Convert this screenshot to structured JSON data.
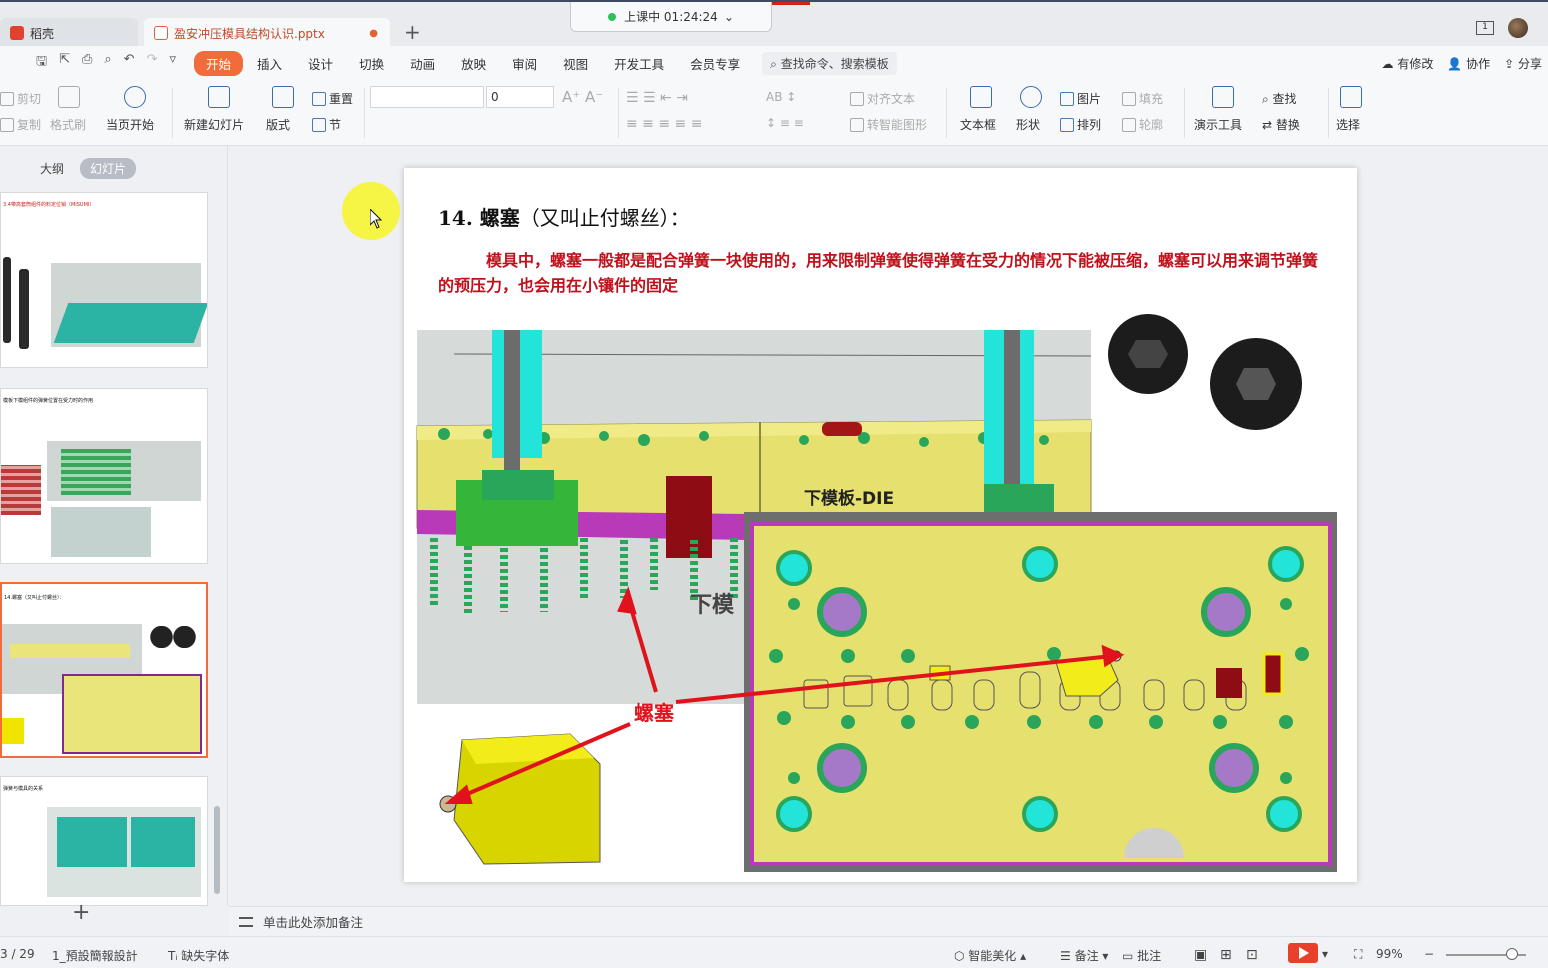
{
  "titlebar": {
    "home_tab": "稻壳",
    "doc_tab": "盈安冲压模具结构认识.pptx",
    "class_status": "上课中 01:24:24",
    "class_chevron": "⌄",
    "add_tab_icon": "+",
    "window_badge": "1"
  },
  "menubar": {
    "items": [
      "开始",
      "插入",
      "设计",
      "切换",
      "动画",
      "放映",
      "审阅",
      "视图",
      "开发工具",
      "会员专享"
    ],
    "search": "查找命令、搜索模板",
    "right": [
      "有修改",
      "协作",
      "分享"
    ]
  },
  "ribbon": {
    "cut": "剪切",
    "copy": "复制",
    "format_painter": "格式刷",
    "play_from_current": "当页开始",
    "new_slide": "新建幻灯片",
    "layout": "版式",
    "reset": "重置",
    "section": "节",
    "font_size": "0",
    "align_text": "对齐文本",
    "convert_smartart": "转智能图形",
    "textbox": "文本框",
    "shape": "形状",
    "picture": "图片",
    "arrange": "排列",
    "fill": "填充",
    "outline": "轮廓",
    "presenter_tools": "演示工具",
    "find": "查找",
    "replace": "替换",
    "select": "选择"
  },
  "left_panel": {
    "tabs": [
      "大纲",
      "幻灯片"
    ],
    "thumb_titles": [
      "3.4带高套筒组件的料定位销（MISUMI）",
      "模板下模组件的弹簧位置在受力时的作用",
      "14.螺塞（又叫止付螺丝）：",
      "弹簧与模具的关系"
    ]
  },
  "slide": {
    "title_num": "14. 螺塞",
    "title_paren": "（又叫止付螺丝）：",
    "body": "模具中，螺塞一般都是配合弹簧一块使用的，用来限制弹簧使得弹簧在受力的情况下能被压缩，螺塞可以用来调节弹簧的预压力，也会用在小镶件的固定",
    "die_label": "下模板-DIE",
    "die_label_partial": "下模",
    "callout": "螺塞"
  },
  "notes": {
    "placeholder": "单击此处添加备注"
  },
  "statusbar": {
    "page": "3 / 29",
    "template": "1_預設簡報設計",
    "missing_font": "缺失字体",
    "beautify": "智能美化",
    "notes": "备注",
    "comments": "批注",
    "zoom": "99%"
  },
  "colors": {
    "accent": "#f26b3a",
    "slide_red": "#c0111b",
    "plate_yellow": "#e9e57a",
    "spring_green": "#2aa65a",
    "screw_cyan": "#22e4d8"
  }
}
